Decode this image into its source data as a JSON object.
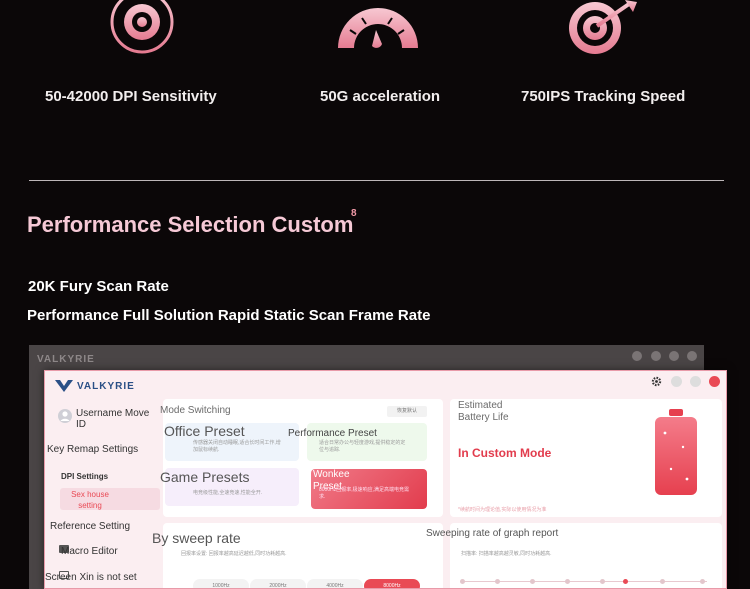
{
  "features": [
    {
      "label": "50-42000 DPI Sensitivity",
      "icon": "crosshair-icon"
    },
    {
      "label": "50G acceleration",
      "icon": "speedometer-icon"
    },
    {
      "label": "750IPS Tracking Speed",
      "icon": "target-arrow-icon"
    }
  ],
  "section": {
    "title": "Performance Selection Custom",
    "footnote": "8",
    "subtitle1": "20K Fury Scan Rate",
    "subtitle2": "Performance Full Solution Rapid Static Scan Frame Rate"
  },
  "bg_app": {
    "brand": "VALKYRIE"
  },
  "app": {
    "brand": "VALKYRIE",
    "sidebar": {
      "user": "Username Move ID",
      "key_remap": "Key Remap Settings",
      "dpi": "DPI Settings",
      "sex_house": "Sex house setting",
      "reference": "Reference Setting",
      "macro": "Macro Editor",
      "screen": "Screen Xin is not set"
    },
    "mode_switching": "Mode Switching",
    "default_btn": "恢复默认",
    "office_preset": "Office Preset",
    "office_desc": "传感器关闭自动睡眠,适合长时间工作,增加鼠标续航.",
    "performance_preset": "Performance Preset",
    "performance_desc": "适合日常办公与轻度游戏,提供稳定的定位与追踪.",
    "game_presets": "Game Presets",
    "game_desc": "电竞级性能,全速竞速,性能全开.",
    "wonkee_preset": "Wonkee Preset",
    "wonkee_desc": "8000Hz回报率,极速响应,满足高端电竞需求.",
    "battery_title": "Estimated Battery Life",
    "custom_mode": "In Custom Mode",
    "battery_note": "*续航时间为理论值,实际以使用情况为准",
    "sweep_rate": "By sweep rate",
    "sweep_desc": "回报率设置: 回报率越高延迟越低,同时功耗越高.",
    "graph_report": "Sweeping rate of graph report",
    "graph_desc": "扫描率: 扫描率越高越灵敏,同时功耗越高.",
    "rates": [
      "1000Hz",
      "2000Hz",
      "4000Hz",
      "8000Hz"
    ],
    "active_rate": "8000Hz",
    "accent": "#e94a55"
  }
}
